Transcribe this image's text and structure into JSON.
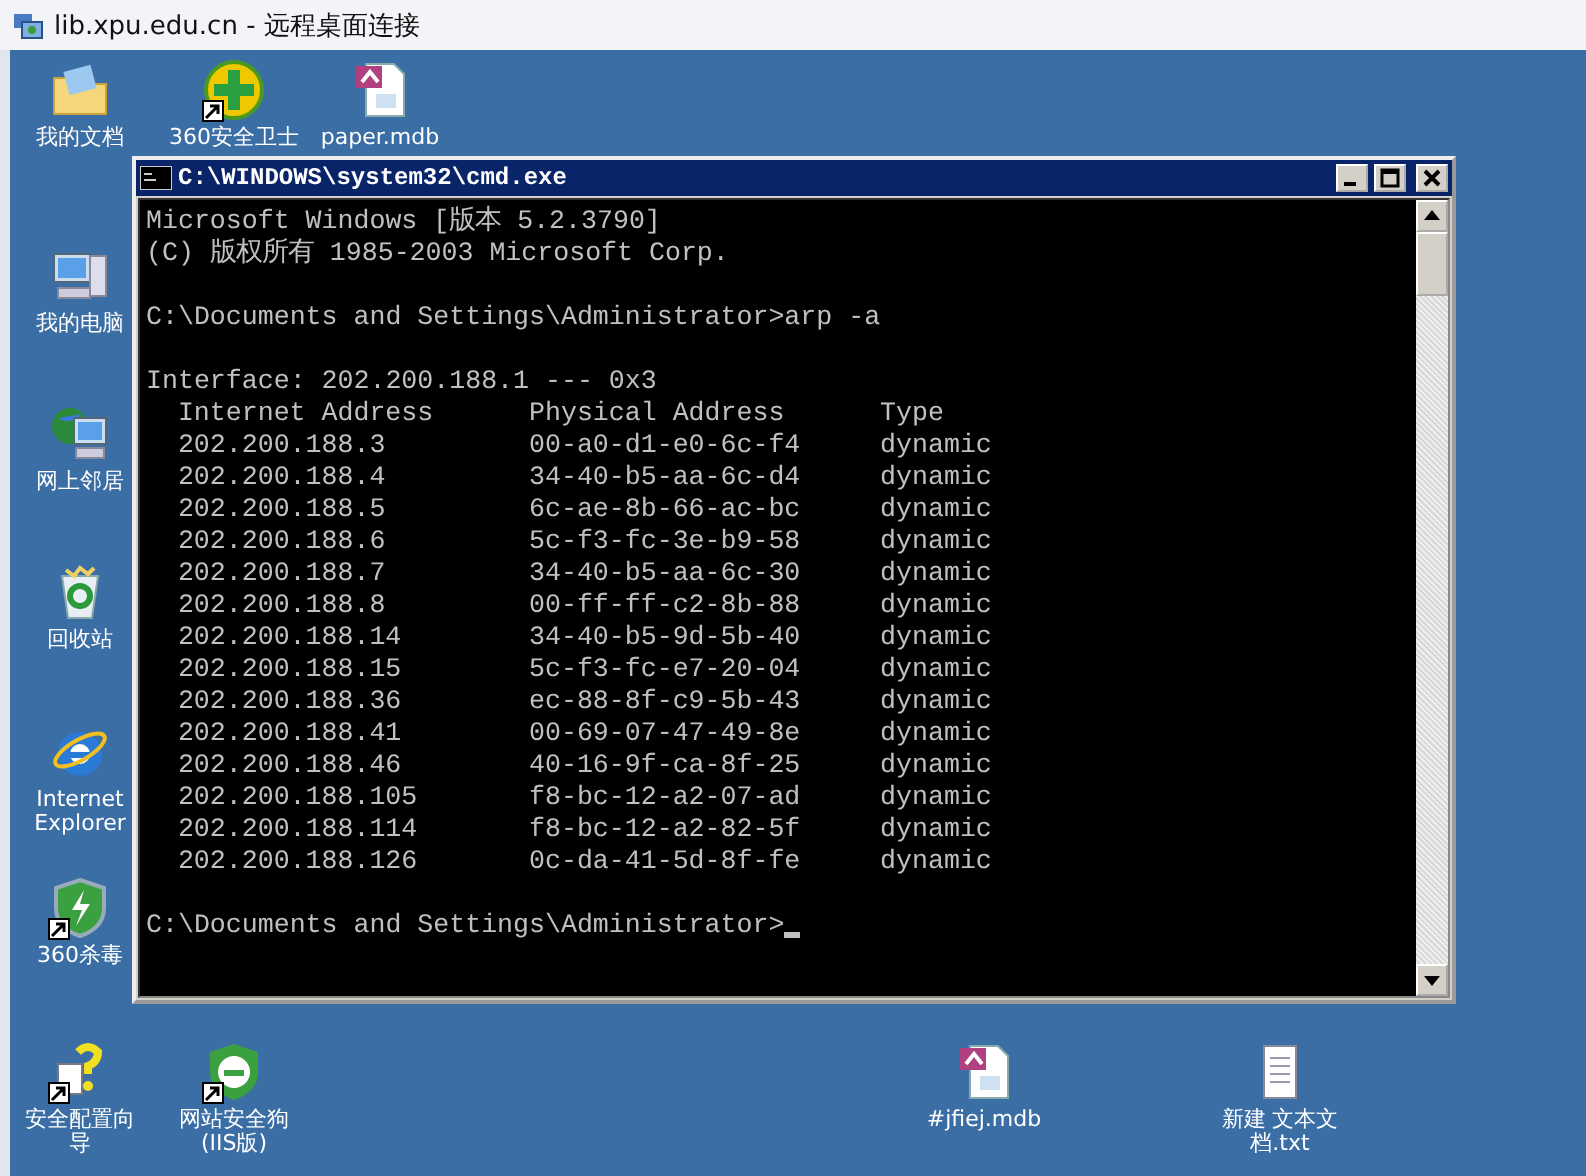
{
  "window": {
    "title": "lib.xpu.edu.cn - 远程桌面连接"
  },
  "desktop_icons": [
    {
      "label": "我的文档",
      "kind": "folder",
      "shortcut": false
    },
    {
      "label": "360安全卫士",
      "kind": "guard",
      "shortcut": true
    },
    {
      "label": "paper.mdb",
      "kind": "access",
      "shortcut": false
    },
    {
      "label": "我的电脑",
      "kind": "computer",
      "shortcut": false
    },
    {
      "label": "网上邻居",
      "kind": "network",
      "shortcut": false
    },
    {
      "label": "回收站",
      "kind": "recycle",
      "shortcut": false
    },
    {
      "label": "Internet Explorer",
      "kind": "ie",
      "shortcut": false
    },
    {
      "label": "360杀毒",
      "kind": "shield",
      "shortcut": true
    },
    {
      "label": "安全配置向导",
      "kind": "wizard",
      "shortcut": true
    },
    {
      "label": "网站安全狗(IIS版)",
      "kind": "dog",
      "shortcut": true
    },
    {
      "label": "#jfiej.mdb",
      "kind": "access",
      "shortcut": false
    },
    {
      "label": "新建 文本文档.txt",
      "kind": "text",
      "shortcut": false
    }
  ],
  "console_window": {
    "title": "C:\\WINDOWS\\system32\\cmd.exe",
    "banner": [
      "Microsoft Windows [版本 5.2.3790]",
      "(C) 版权所有 1985-2003 Microsoft Corp."
    ],
    "command_line": "C:\\Documents and Settings\\Administrator>arp -a",
    "interface_line": "Interface: 202.200.188.1 --- 0x3",
    "table": {
      "columns": [
        "Internet Address",
        "Physical Address",
        "Type"
      ],
      "rows": [
        [
          "202.200.188.3",
          "00-a0-d1-e0-6c-f4",
          "dynamic"
        ],
        [
          "202.200.188.4",
          "34-40-b5-aa-6c-d4",
          "dynamic"
        ],
        [
          "202.200.188.5",
          "6c-ae-8b-66-ac-bc",
          "dynamic"
        ],
        [
          "202.200.188.6",
          "5c-f3-fc-3e-b9-58",
          "dynamic"
        ],
        [
          "202.200.188.7",
          "34-40-b5-aa-6c-30",
          "dynamic"
        ],
        [
          "202.200.188.8",
          "00-ff-ff-c2-8b-88",
          "dynamic"
        ],
        [
          "202.200.188.14",
          "34-40-b5-9d-5b-40",
          "dynamic"
        ],
        [
          "202.200.188.15",
          "5c-f3-fc-e7-20-04",
          "dynamic"
        ],
        [
          "202.200.188.36",
          "ec-88-8f-c9-5b-43",
          "dynamic"
        ],
        [
          "202.200.188.41",
          "00-69-07-47-49-8e",
          "dynamic"
        ],
        [
          "202.200.188.46",
          "40-16-9f-ca-8f-25",
          "dynamic"
        ],
        [
          "202.200.188.105",
          "f8-bc-12-a2-07-ad",
          "dynamic"
        ],
        [
          "202.200.188.114",
          "f8-bc-12-a2-82-5f",
          "dynamic"
        ],
        [
          "202.200.188.126",
          "0c-da-41-5d-8f-fe",
          "dynamic"
        ]
      ]
    },
    "prompt": "C:\\Documents and Settings\\Administrator>",
    "cursor": true
  }
}
